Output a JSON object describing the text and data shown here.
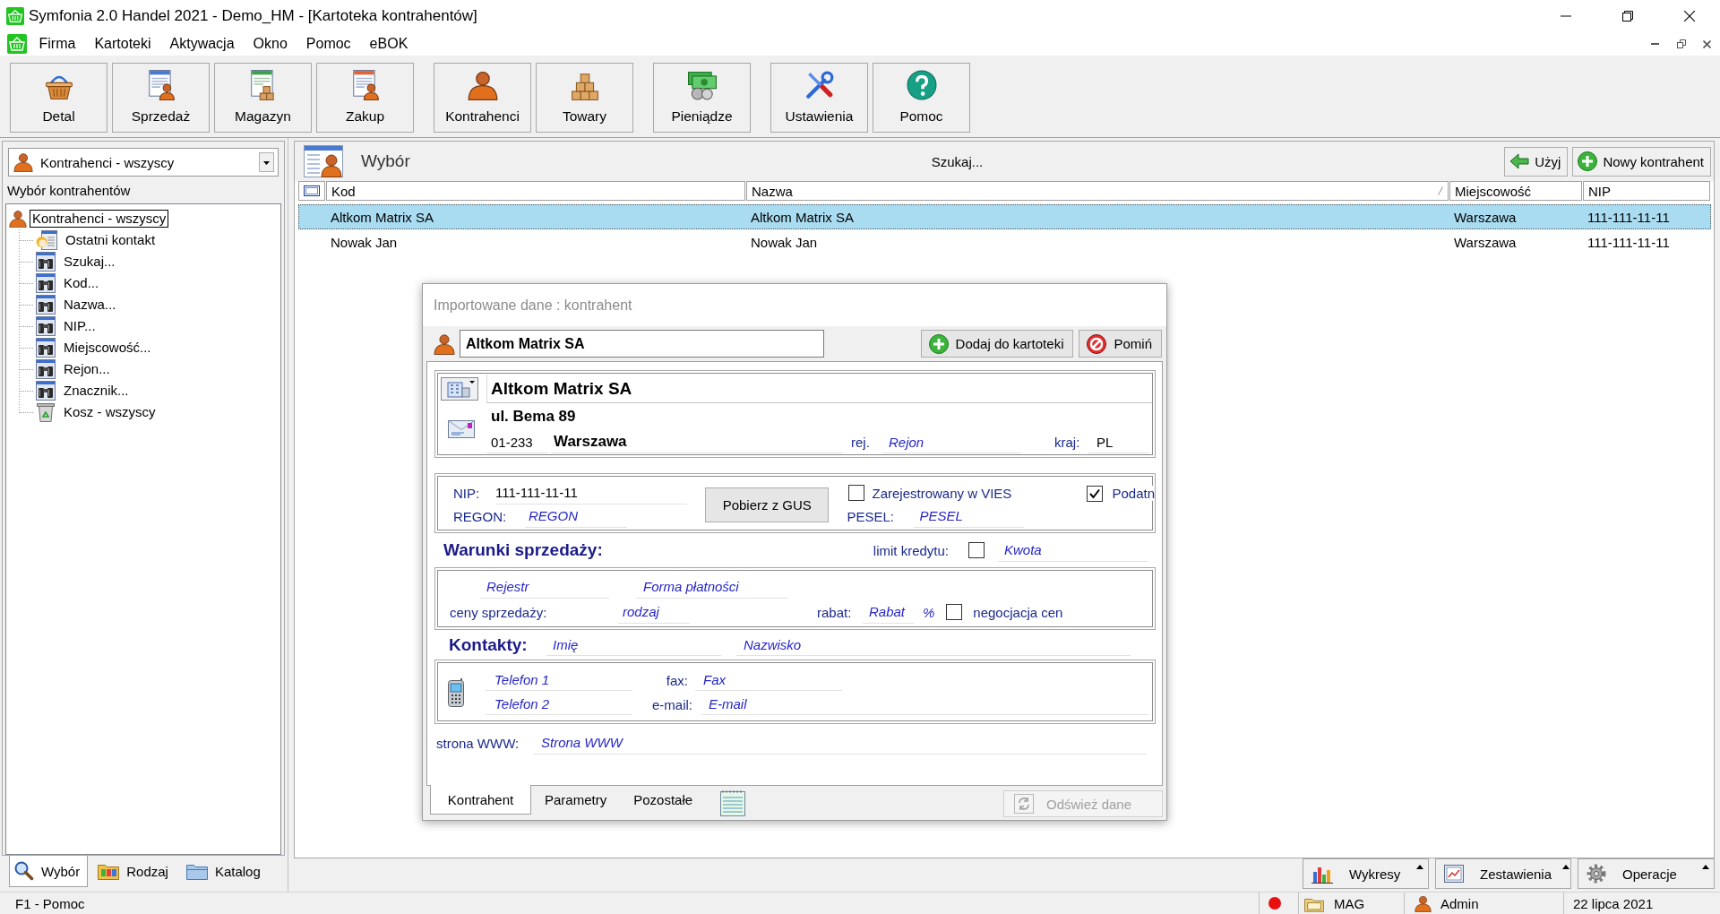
{
  "window": {
    "title": "Symfonia 2.0 Handel 2021 - Demo_HM - [Kartoteka kontrahentów]"
  },
  "menu": [
    {
      "label": "Firma"
    },
    {
      "label": "Kartoteki"
    },
    {
      "label": "Aktywacja"
    },
    {
      "label": "Okno"
    },
    {
      "label": "Pomoc"
    },
    {
      "label": "eBOK"
    }
  ],
  "toolbar": {
    "groups": [
      [
        {
          "label": "Detal"
        },
        {
          "label": "Sprzedaż"
        },
        {
          "label": "Magazyn"
        },
        {
          "label": "Zakup"
        }
      ],
      [
        {
          "label": "Kontrahenci"
        },
        {
          "label": "Towary"
        }
      ],
      [
        {
          "label": "Pieniądze"
        }
      ],
      [
        {
          "label": "Ustawienia"
        },
        {
          "label": "Pomoc"
        }
      ]
    ]
  },
  "left_panel": {
    "filter_dropdown": {
      "value": "Kontrahenci - wszyscy"
    },
    "tree_title": "Wybór kontrahentów",
    "tree": [
      {
        "label": "Kontrahenci - wszyscy",
        "kind": "group",
        "selected": true,
        "children": [
          {
            "label": "Ostatni kontakt",
            "kind": "recent",
            "selected": false
          },
          {
            "label": "Szukaj...",
            "kind": "search",
            "selected": false
          },
          {
            "label": "Kod...",
            "kind": "search",
            "selected": false
          },
          {
            "label": "Nazwa...",
            "kind": "search",
            "selected": false
          },
          {
            "label": "NIP...",
            "kind": "search",
            "selected": false
          },
          {
            "label": "Miejscowość...",
            "kind": "search",
            "selected": false
          },
          {
            "label": "Rejon...",
            "kind": "search",
            "selected": false
          },
          {
            "label": "Znacznik...",
            "kind": "search",
            "selected": false
          },
          {
            "label": "Kosz - wszyscy",
            "kind": "trash",
            "selected": false
          }
        ]
      }
    ],
    "tabs": [
      {
        "label": "Wybór",
        "selected": true
      },
      {
        "label": "Rodzaj",
        "selected": false
      },
      {
        "label": "Katalog",
        "selected": false
      }
    ]
  },
  "list_panel": {
    "title": "Wybór",
    "search_label": "Szukaj...",
    "buttons": [
      {
        "label": "Użyj"
      },
      {
        "label": "Nowy kontrahent"
      }
    ],
    "table": {
      "columns": [
        {
          "label": "Kod"
        },
        {
          "label": "Nazwa"
        },
        {
          "label": "Miejscowość"
        },
        {
          "label": "NIP"
        }
      ],
      "rows": [
        {
          "selected": true,
          "cells": [
            "Altkom Matrix SA",
            "Altkom Matrix SA",
            "Warszawa",
            "111-111-11-11"
          ]
        },
        {
          "selected": false,
          "cells": [
            "Nowak Jan",
            "Nowak Jan",
            "Warszawa",
            "111-111-11-11"
          ]
        }
      ]
    }
  },
  "dialog": {
    "title": "Importowane dane : kontrahent",
    "name_field": {
      "value": "Altkom Matrix SA"
    },
    "buttons": [
      {
        "label": "Dodaj do kartoteki"
      },
      {
        "label": "Pomiń"
      }
    ],
    "address": {
      "company_name": {
        "value": "Altkom Matrix SA"
      },
      "street": {
        "value": "ul. Bema 89"
      },
      "postal_code": {
        "value": "01-233"
      },
      "city": {
        "value": "Warszawa"
      },
      "region_label": "rej.",
      "region": {
        "placeholder": "Rejon"
      },
      "country_label": "kraj:",
      "country": {
        "value": "PL"
      }
    },
    "identifiers": {
      "nip_label": "NIP:",
      "nip": {
        "value": "111-111-11-11"
      },
      "regon_label": "REGON:",
      "regon": {
        "placeholder": "REGON"
      },
      "gus_button": {
        "label": "Pobierz z GUS"
      },
      "vies": {
        "label": "Zarejestrowany w VIES",
        "checked": false
      },
      "pesel_label": "PESEL:",
      "pesel": {
        "placeholder": "PESEL"
      },
      "vat_payer": {
        "label": "Podatn",
        "checked": true
      }
    },
    "sales_terms": {
      "title": "Warunki sprzedaży:",
      "credit_limit": {
        "label": "limit kredytu:",
        "checked": false
      },
      "credit_amount": {
        "placeholder": "Kwota"
      },
      "register": {
        "placeholder": "Rejestr"
      },
      "payment_form": {
        "placeholder": "Forma płatności"
      },
      "prices_label": "ceny sprzedaży:",
      "price_type": {
        "placeholder": "rodzaj"
      },
      "discount_label": "rabat:",
      "discount": {
        "placeholder": "Rabat"
      },
      "discount_unit": "%",
      "price_negotiation": {
        "label": "negocjacja cen",
        "checked": false
      }
    },
    "contacts": {
      "title": "Kontakty:",
      "first_name": {
        "placeholder": "Imię"
      },
      "last_name": {
        "placeholder": "Nazwisko"
      },
      "phone_1": {
        "placeholder": "Telefon 1"
      },
      "fax_label": "fax:",
      "fax": {
        "placeholder": "Fax"
      },
      "phone_2": {
        "placeholder": "Telefon 2"
      },
      "email_label": "e-mail:",
      "email": {
        "placeholder": "E-mail"
      }
    },
    "website": {
      "label": "strona WWW:",
      "field": {
        "placeholder": "Strona WWW"
      }
    },
    "tabs": [
      {
        "label": "Kontrahent",
        "selected": true
      },
      {
        "label": "Parametry",
        "selected": false
      },
      {
        "label": "Pozostałe",
        "selected": false
      }
    ],
    "refresh_button": {
      "label": "Odśwież dane",
      "disabled": true
    }
  },
  "report_buttons": [
    {
      "label": "Wykresy"
    },
    {
      "label": "Zestawienia"
    },
    {
      "label": "Operacje"
    }
  ],
  "status_bar": {
    "help": "F1 - Pomoc",
    "warehouse": "MAG",
    "user": "Admin",
    "date": "22 lipca 2021"
  }
}
